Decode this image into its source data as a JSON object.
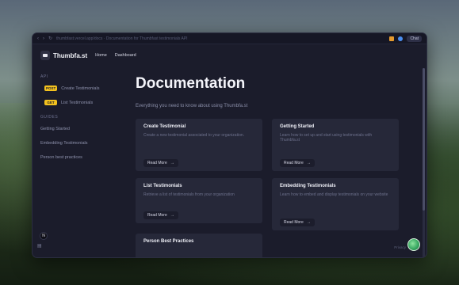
{
  "browser": {
    "url": "thumbfast.vercel.app/docs · Documentation for Thumbfast testimonials API",
    "chat_label": "Chat"
  },
  "nav": {
    "brand": "Thumbfa.st",
    "links": [
      "Home",
      "Dashboard"
    ]
  },
  "sidebar": {
    "api_label": "API",
    "api_items": [
      {
        "method": "POST",
        "label": "Create Testimonials"
      },
      {
        "method": "GET",
        "label": "List Testimonials"
      }
    ],
    "guides_label": "GUIDES",
    "guide_items": [
      "Getting Started",
      "Embedding Testimonials",
      "Person best practices"
    ],
    "avatar_letter": "N"
  },
  "main": {
    "title": "Documentation",
    "subtitle": "Everything you need to know about using Thumbfa.st",
    "cards": [
      {
        "title": "Create Testimonial",
        "desc": "Create a new testimonial associated to your organization.",
        "button": "Read More"
      },
      {
        "title": "Getting Started",
        "desc": "Learn how to set up and start using testimonials with Thumbfa.st",
        "button": "Read More"
      },
      {
        "title": "List Testimonials",
        "desc": "Retrieve a list of testimonials from your organization",
        "button": "Read More"
      },
      {
        "title": "Embedding Testimonials",
        "desc": "Learn how to embed and display testimonials on your website",
        "button": "Read More"
      },
      {
        "title": "Person Best Practices",
        "desc": "",
        "button": ""
      }
    ]
  },
  "footer": {
    "privacy": "Privacy"
  },
  "colors": {
    "badge": "#f4c21e",
    "card_bg": "#262839",
    "window_bg": "#1b1c2b"
  }
}
